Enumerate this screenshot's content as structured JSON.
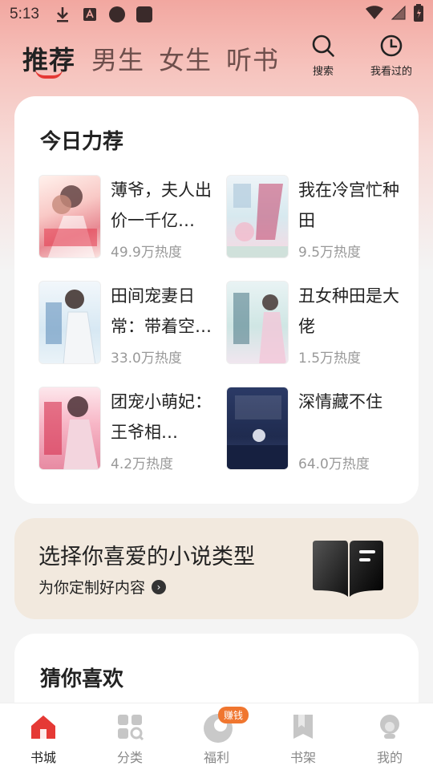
{
  "status_bar": {
    "time": "5:13"
  },
  "header": {
    "tabs": [
      "推荐",
      "男生",
      "女生",
      "听书"
    ],
    "search_label": "搜索",
    "history_label": "我看过的"
  },
  "today_section": {
    "title": "今日力荐",
    "books": [
      {
        "title": "薄爷，夫人出价一千亿…",
        "heat": "49.9万热度"
      },
      {
        "title": "我在冷宫忙种田",
        "heat": "9.5万热度"
      },
      {
        "title": "田间宠妻日常：带着空…",
        "heat": "33.0万热度"
      },
      {
        "title": "丑女种田是大佬",
        "heat": "1.5万热度"
      },
      {
        "title": "团宠小萌妃：王爷相…",
        "heat": "4.2万热度"
      },
      {
        "title": "深情藏不住",
        "heat": "64.0万热度"
      }
    ]
  },
  "preference_banner": {
    "title": "选择你喜爱的小说类型",
    "subtitle": "为你定制好内容"
  },
  "guess_section": {
    "title": "猜你喜欢"
  },
  "bottom_nav": {
    "items": [
      {
        "label": "书城",
        "icon": "home-icon"
      },
      {
        "label": "分类",
        "icon": "category-icon"
      },
      {
        "label": "福利",
        "icon": "welfare-icon",
        "badge": "赚钱"
      },
      {
        "label": "书架",
        "icon": "bookshelf-icon"
      },
      {
        "label": "我的",
        "icon": "profile-icon"
      }
    ]
  },
  "colors": {
    "accent": "#e53935",
    "badge": "#f0762f",
    "banner_bg": "#f2e9de"
  }
}
